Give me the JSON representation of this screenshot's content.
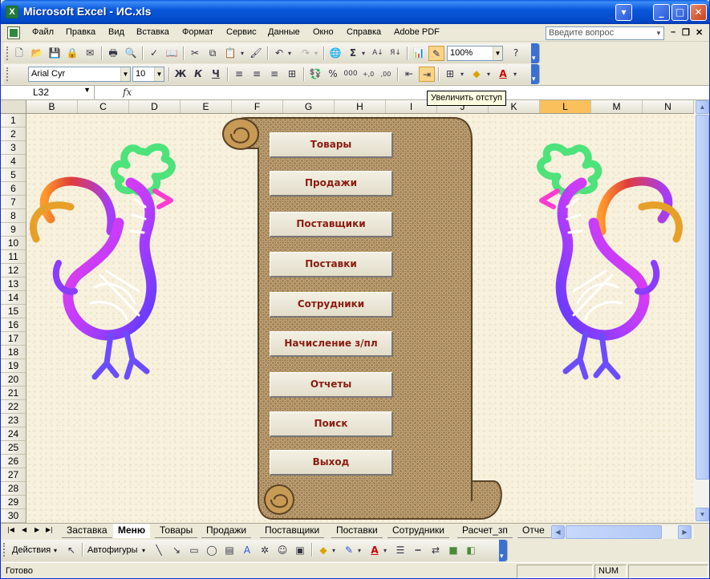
{
  "window": {
    "title": "Microsoft Excel - ИС.xls"
  },
  "menu": {
    "items": [
      "Файл",
      "Правка",
      "Вид",
      "Вставка",
      "Формат",
      "Сервис",
      "Данные",
      "Окно",
      "Справка",
      "Adobe PDF"
    ],
    "help_placeholder": "Введите вопрос"
  },
  "toolbar": {
    "zoom": "100%",
    "font_name": "Arial Cyr",
    "font_size": "10",
    "bold": "Ж",
    "italic": "К",
    "underline": "Ч",
    "tooltip": "Увеличить отступ"
  },
  "formula": {
    "cell_ref": "L32",
    "fx": "fx"
  },
  "columns": [
    "B",
    "C",
    "D",
    "E",
    "F",
    "G",
    "H",
    "I",
    "J",
    "K",
    "L",
    "M",
    "N"
  ],
  "selected_column": "L",
  "rows": [
    "1",
    "2",
    "3",
    "4",
    "5",
    "6",
    "7",
    "8",
    "9",
    "10",
    "11",
    "12",
    "13",
    "14",
    "15",
    "16",
    "17",
    "18",
    "19",
    "20",
    "21",
    "22",
    "23",
    "24",
    "25",
    "26",
    "27",
    "28",
    "29",
    "30"
  ],
  "menu_buttons": [
    "Товары",
    "Продажи",
    "Поставщики",
    "Поставки",
    "Сотрудники",
    "Начисление з/пл",
    "Отчеты",
    "Поиск",
    "Выход"
  ],
  "sheet_tabs": [
    "Заставка",
    "Меню",
    "Товары",
    "Продажи",
    "Поставщики",
    "Поставки",
    "Сотрудники",
    "Расчет_зп",
    "Отче"
  ],
  "active_tab": "Меню",
  "drawing": {
    "actions": "Действия",
    "autoshapes": "Автофигуры"
  },
  "status": {
    "ready": "Готово",
    "num": "NUM"
  },
  "colors": {
    "title_bar": "#0a58dc",
    "button_text": "#8b1c12",
    "selected_header": "#f9c05c"
  }
}
